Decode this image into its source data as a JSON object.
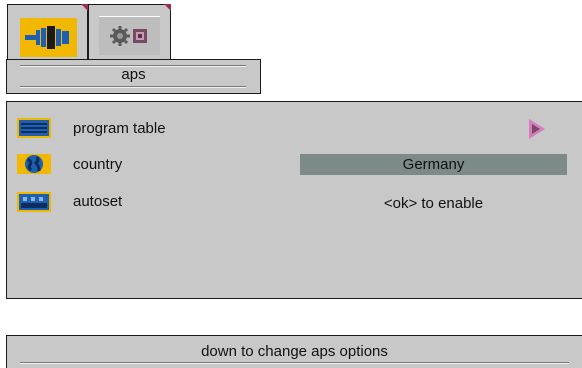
{
  "tabs": [
    {
      "icon": "signal-connector-icon",
      "active": true
    },
    {
      "icon": "settings-gear-icon",
      "active": false
    }
  ],
  "section_label": "aps",
  "menu": {
    "items": [
      {
        "icon": "program-table-icon",
        "label": "program table",
        "value": "",
        "value_icon": "submenu-arrow-icon"
      },
      {
        "icon": "country-globe-icon",
        "label": "country",
        "value": "Germany"
      },
      {
        "icon": "autoset-icon",
        "label": "autoset",
        "value": "<ok> to enable"
      }
    ]
  },
  "status": {
    "hint": "down to change aps options"
  },
  "colors": {
    "panel": "#c8c8c8",
    "selected_value_bg": "#7c8a89",
    "active_tab_icon_bg": "#f2b800",
    "submenu_arrow": "#d77ac0"
  }
}
